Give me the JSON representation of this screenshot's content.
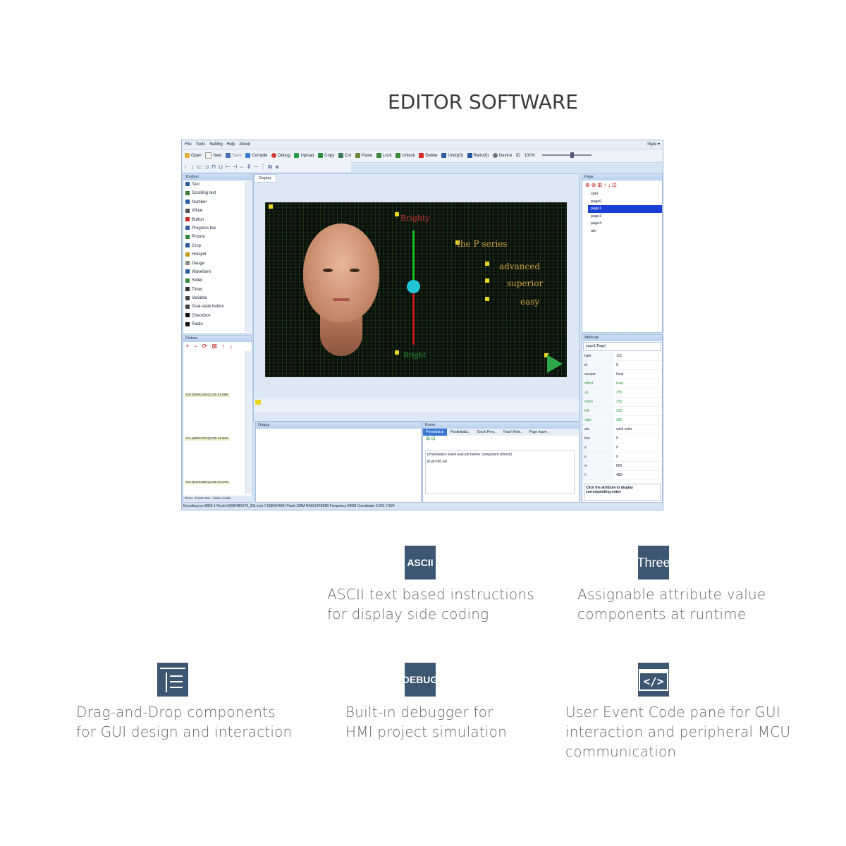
{
  "heading": "EDITOR SOFTWARE",
  "editor": {
    "menu": [
      "File",
      "Tools",
      "Setting",
      "Help",
      "About"
    ],
    "style_label": "Style ▾",
    "toolbar": [
      "Open",
      "New",
      "Save",
      "Compile",
      "Debug",
      "Upload",
      "Copy",
      "Cut",
      "Paste",
      "Lock",
      "Unlock",
      "Delete",
      "Undo(0)",
      "Redo(0)",
      "Device",
      "ID",
      "100%"
    ],
    "toolbox_title": "Toolbox",
    "toolbox_items": [
      "Text",
      "Scrolling text",
      "Number",
      "Xfloat",
      "Button",
      "Progress bar",
      "Picture",
      "Crop",
      "Hotspot",
      "Gauge",
      "Waveform",
      "Slider",
      "Timer",
      "Variable",
      "Dual-state button",
      "Checkbox",
      "Radio"
    ],
    "picture_title": "Picture",
    "picture_tools": "+ − ⟳ ⊠ ↑ ↓",
    "pictures": [
      "0:0 (200X144 Q:100 27.69K",
      "0:1 (260X176 Q:100 41.61K",
      "0:2 (272X192 Q:100 24.47K"
    ],
    "picture_tabs": "Pictu.. Fonts Gm.. Video Audio",
    "display_tab": "Display",
    "screen": {
      "title_text": "the P series",
      "top_text": "Brighty",
      "bottom_text": "Bright",
      "line1": "advanced",
      "line2": "superior",
      "line3": "easy"
    },
    "output_title": "Output",
    "event_title": "Event",
    "event_tabs": [
      "Preinitialize",
      "Postinitializ..",
      "Touch Pres..",
      "Touch Rele..",
      "Page leave.."
    ],
    "event_comment": "(Preinitialize event execute before component refresh)",
    "event_code": "j0.pic=h0.val",
    "page_title": "Page",
    "pages": [
      "start",
      "page0",
      "page1",
      "page2",
      "page3",
      "afe"
    ],
    "attribute_title": "Attribute",
    "attribute_select": "page1(Page)",
    "attributes": [
      {
        "k": "type",
        "v": "121"
      },
      {
        "k": "id",
        "v": "0"
      },
      {
        "k": "vscope",
        "v": "local"
      },
      {
        "k": "effect",
        "v": "load"
      },
      {
        "k": "up",
        "v": "255"
      },
      {
        "k": "down",
        "v": "255"
      },
      {
        "k": "left",
        "v": "255"
      },
      {
        "k": "right",
        "v": "255"
      },
      {
        "k": "sta",
        "v": "solid color"
      },
      {
        "k": "bco",
        "v": "0"
      },
      {
        "k": "x",
        "v": "0"
      },
      {
        "k": "y",
        "v": "0"
      },
      {
        "k": "w",
        "v": "800"
      },
      {
        "k": "h",
        "v": "480"
      }
    ],
    "attribute_hint": "Click the attribute to display corresponding notes",
    "status": "Encoding:iso-8859-1 Model:NX8048K070_011 inch:7.0(800X480) Flash:128M RAM:524288B Frequency:200M    Coordinate X:201 Y:524"
  },
  "features": [
    {
      "icon": "ASCII",
      "icon_name": "ascii-icon",
      "lines": [
        "ASCII text based instructions",
        "for display side coding"
      ]
    },
    {
      "icon": "Three",
      "icon_name": "three-icon",
      "lines": [
        "Assignable attribute value",
        "components at runtime"
      ]
    },
    {
      "icon": "",
      "icon_name": "layout-icon",
      "lines": [
        "Drag-and-Drop components",
        "for GUI design and interaction"
      ]
    },
    {
      "icon": "DEBUG",
      "icon_name": "debug-icon",
      "lines": [
        "Built-in debugger for",
        "HMI project simulation"
      ]
    },
    {
      "icon": "</>",
      "icon_name": "code-icon",
      "lines": [
        "User Event Code pane for GUI",
        "interaction and peripheral MCU",
        "communication"
      ]
    }
  ],
  "colors": {
    "icon_bg": "#3d5671",
    "panel_blue": "#d6e3f3",
    "selection": "#1a3fd6"
  }
}
